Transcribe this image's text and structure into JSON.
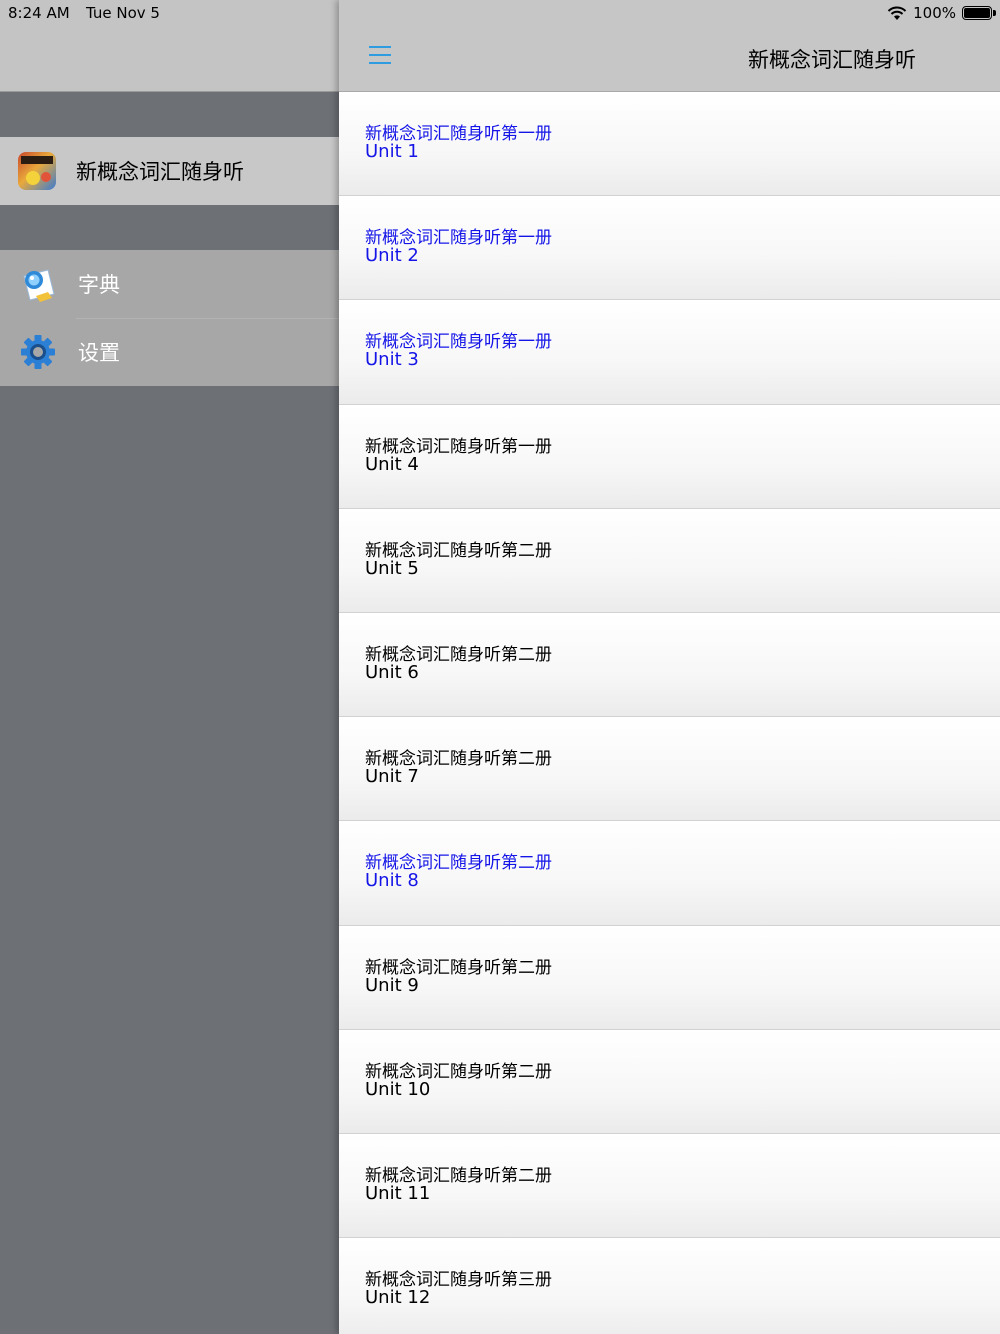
{
  "status_bar": {
    "time": "8:24 AM",
    "date": "Tue Nov 5",
    "battery": "100%"
  },
  "sidebar": {
    "app_item": {
      "label": "新概念词汇随身听",
      "icon": "app-icon"
    },
    "items": [
      {
        "label": "字典",
        "icon": "dictionary-icon"
      },
      {
        "label": "设置",
        "icon": "gear-icon"
      }
    ]
  },
  "nav": {
    "title": "新概念词汇随身听",
    "menu_icon": "hamburger-menu-icon"
  },
  "list": {
    "rows": [
      {
        "title": "新概念词汇随身听第一册",
        "unit": "Unit 1",
        "highlighted": true
      },
      {
        "title": "新概念词汇随身听第一册",
        "unit": "Unit 2",
        "highlighted": true
      },
      {
        "title": "新概念词汇随身听第一册",
        "unit": "Unit 3",
        "highlighted": true
      },
      {
        "title": "新概念词汇随身听第一册",
        "unit": "Unit 4",
        "highlighted": false
      },
      {
        "title": "新概念词汇随身听第二册",
        "unit": "Unit 5",
        "highlighted": false
      },
      {
        "title": "新概念词汇随身听第二册",
        "unit": "Unit 6",
        "highlighted": false
      },
      {
        "title": "新概念词汇随身听第二册",
        "unit": "Unit 7",
        "highlighted": false
      },
      {
        "title": "新概念词汇随身听第二册",
        "unit": "Unit 8",
        "highlighted": true
      },
      {
        "title": "新概念词汇随身听第二册",
        "unit": "Unit 9",
        "highlighted": false
      },
      {
        "title": "新概念词汇随身听第二册",
        "unit": "Unit 10",
        "highlighted": false
      },
      {
        "title": "新概念词汇随身听第二册",
        "unit": "Unit 11",
        "highlighted": false
      },
      {
        "title": "新概念词汇随身听第三册",
        "unit": "Unit 12",
        "highlighted": false
      }
    ]
  },
  "colors": {
    "highlight": "#1515e8",
    "accent": "#2f9be0",
    "sidebar_bg": "#6d7176"
  }
}
